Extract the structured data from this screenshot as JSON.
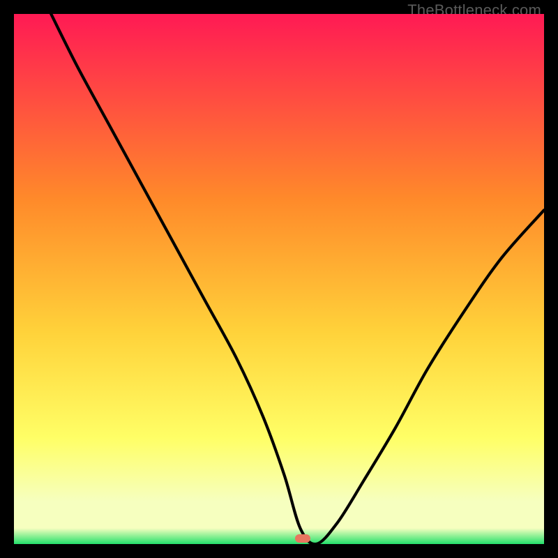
{
  "watermark": "TheBottleneck.com",
  "colors": {
    "top": "#ff1a54",
    "mid_upper": "#ff8a2a",
    "mid": "#ffd23a",
    "mid_lower": "#ffff66",
    "pale": "#f6ffbf",
    "green": "#23e06a",
    "marker": "#e8765f",
    "curve": "#000000",
    "frame": "#000000"
  },
  "marker": {
    "x_pct": 54.5,
    "y_pct": 99.0
  },
  "chart_data": {
    "type": "line",
    "title": "",
    "xlabel": "",
    "ylabel": "",
    "xlim": [
      0,
      100
    ],
    "ylim": [
      0,
      100
    ],
    "series": [
      {
        "name": "bottleneck-curve",
        "x": [
          7,
          12,
          18,
          24,
          30,
          36,
          42,
          47,
          51,
          54,
          57,
          61,
          66,
          72,
          78,
          85,
          92,
          100
        ],
        "y": [
          100,
          90,
          79,
          68,
          57,
          46,
          35,
          24,
          13,
          3,
          0,
          4,
          12,
          22,
          33,
          44,
          54,
          63
        ]
      }
    ],
    "annotations": [
      {
        "type": "flat-min",
        "x_range": [
          51,
          57
        ],
        "y": 0
      },
      {
        "type": "marker",
        "x": 54.5,
        "y": 1
      }
    ]
  }
}
